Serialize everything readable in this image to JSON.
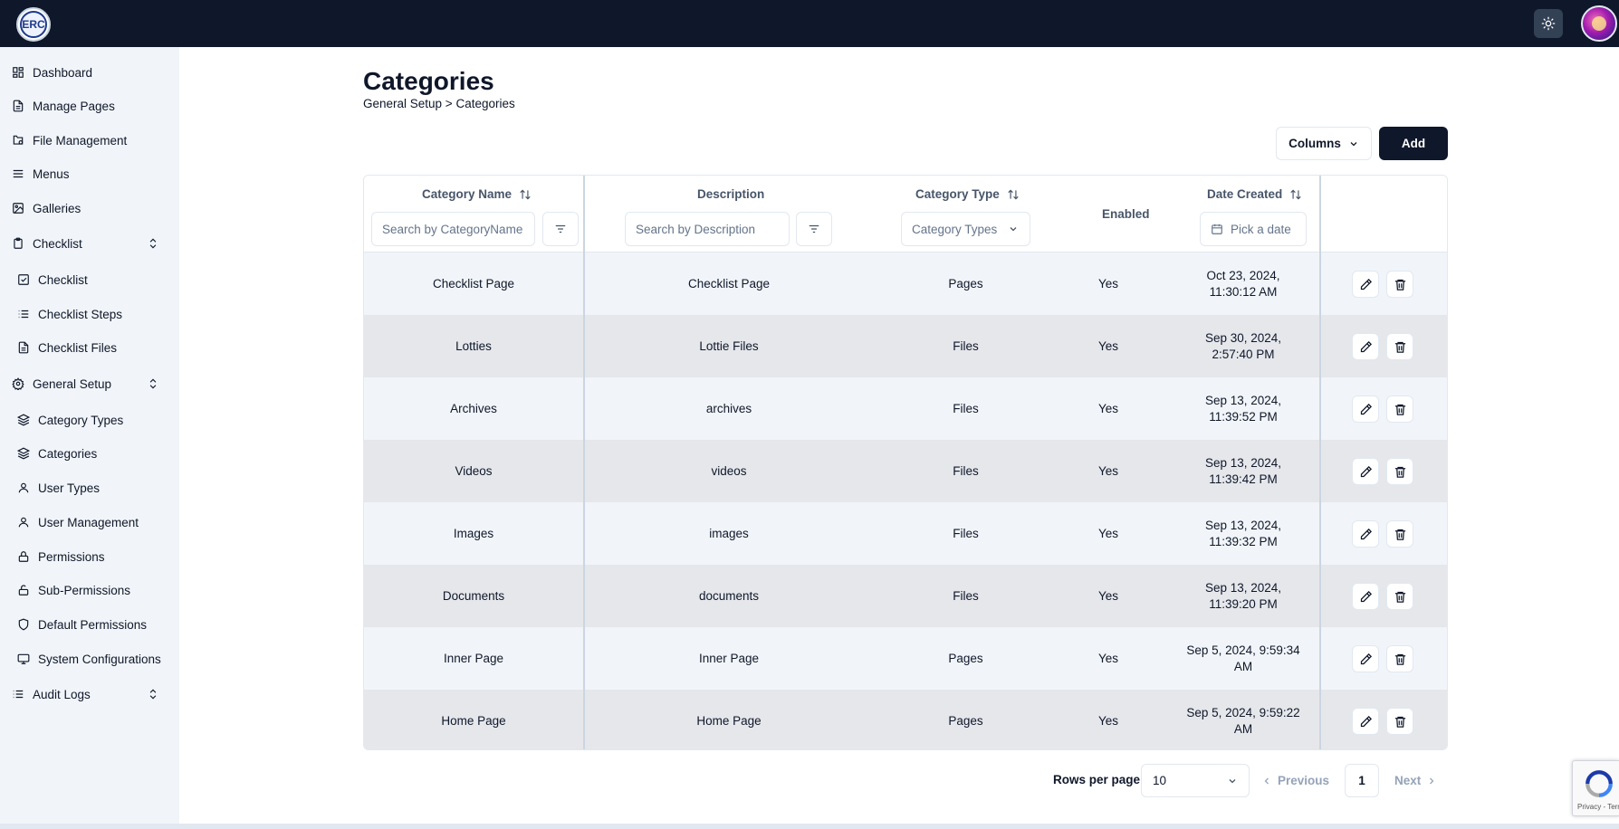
{
  "header": {
    "logo_text": "ERC",
    "theme_toggle_icon": "sun-icon",
    "avatar_icon": "user-avatar"
  },
  "sidebar": {
    "items": [
      {
        "label": "Dashboard",
        "icon": "dashboard-icon"
      },
      {
        "label": "Manage Pages",
        "icon": "file-icon"
      },
      {
        "label": "File Management",
        "icon": "folder-icon"
      },
      {
        "label": "Menus",
        "icon": "menu-icon"
      },
      {
        "label": "Galleries",
        "icon": "image-icon"
      },
      {
        "label": "Checklist",
        "icon": "clipboard-icon",
        "expandable": true
      },
      {
        "label": "Checklist",
        "icon": "checkbox-icon"
      },
      {
        "label": "Checklist Steps",
        "icon": "list-icon"
      },
      {
        "label": "Checklist Files",
        "icon": "file-icon"
      },
      {
        "label": "General Setup",
        "icon": "gear-icon",
        "expandable": true
      },
      {
        "label": "Category Types",
        "icon": "layers-icon"
      },
      {
        "label": "Categories",
        "icon": "layers-icon"
      },
      {
        "label": "User Types",
        "icon": "user-icon"
      },
      {
        "label": "User Management",
        "icon": "user-icon"
      },
      {
        "label": "Permissions",
        "icon": "lock-icon"
      },
      {
        "label": "Sub-Permissions",
        "icon": "unlock-icon"
      },
      {
        "label": "Default Permissions",
        "icon": "shield-icon"
      },
      {
        "label": "System Configurations",
        "icon": "monitor-icon"
      },
      {
        "label": "Audit Logs",
        "icon": "list-icon",
        "expandable": true
      }
    ]
  },
  "page": {
    "title": "Categories",
    "breadcrumb": "General Setup > Categories",
    "columns_button": "Columns",
    "add_button": "Add"
  },
  "table": {
    "headers": {
      "category_name": "Category Name",
      "description": "Description",
      "category_type": "Category Type",
      "enabled": "Enabled",
      "date_created": "Date Created"
    },
    "filters": {
      "category_name_placeholder": "Search by CategoryName",
      "description_placeholder": "Search by Description",
      "category_type_select": "Category Types",
      "date_placeholder": "Pick a date"
    },
    "rows": [
      {
        "name": "Checklist Page",
        "description": "Checklist Page",
        "type": "Pages",
        "enabled": "Yes",
        "date": "Oct 23, 2024, 11:30:12 AM"
      },
      {
        "name": "Lotties",
        "description": "Lottie Files",
        "type": "Files",
        "enabled": "Yes",
        "date": "Sep 30, 2024, 2:57:40 PM"
      },
      {
        "name": "Archives",
        "description": "archives",
        "type": "Files",
        "enabled": "Yes",
        "date": "Sep 13, 2024, 11:39:52 PM"
      },
      {
        "name": "Videos",
        "description": "videos",
        "type": "Files",
        "enabled": "Yes",
        "date": "Sep 13, 2024, 11:39:42 PM"
      },
      {
        "name": "Images",
        "description": "images",
        "type": "Files",
        "enabled": "Yes",
        "date": "Sep 13, 2024, 11:39:32 PM"
      },
      {
        "name": "Documents",
        "description": "documents",
        "type": "Files",
        "enabled": "Yes",
        "date": "Sep 13, 2024, 11:39:20 PM"
      },
      {
        "name": "Inner Page",
        "description": "Inner Page",
        "type": "Pages",
        "enabled": "Yes",
        "date": "Sep 5, 2024, 9:59:34 AM"
      },
      {
        "name": "Home Page",
        "description": "Home Page",
        "type": "Pages",
        "enabled": "Yes",
        "date": "Sep 5, 2024, 9:59:22 AM"
      }
    ]
  },
  "pagination": {
    "rows_per_page_label": "Rows per page",
    "rows_per_page_value": "10",
    "previous": "Previous",
    "current_page": "1",
    "next": "Next"
  },
  "recaptcha": {
    "text": "Privacy - Terms"
  },
  "colors": {
    "navbar": "#0f172a",
    "sidebar": "#f1f5f9",
    "row_light": "#f1f5f9",
    "row_dark": "#e5e7eb",
    "primary_button": "#0f172a"
  }
}
